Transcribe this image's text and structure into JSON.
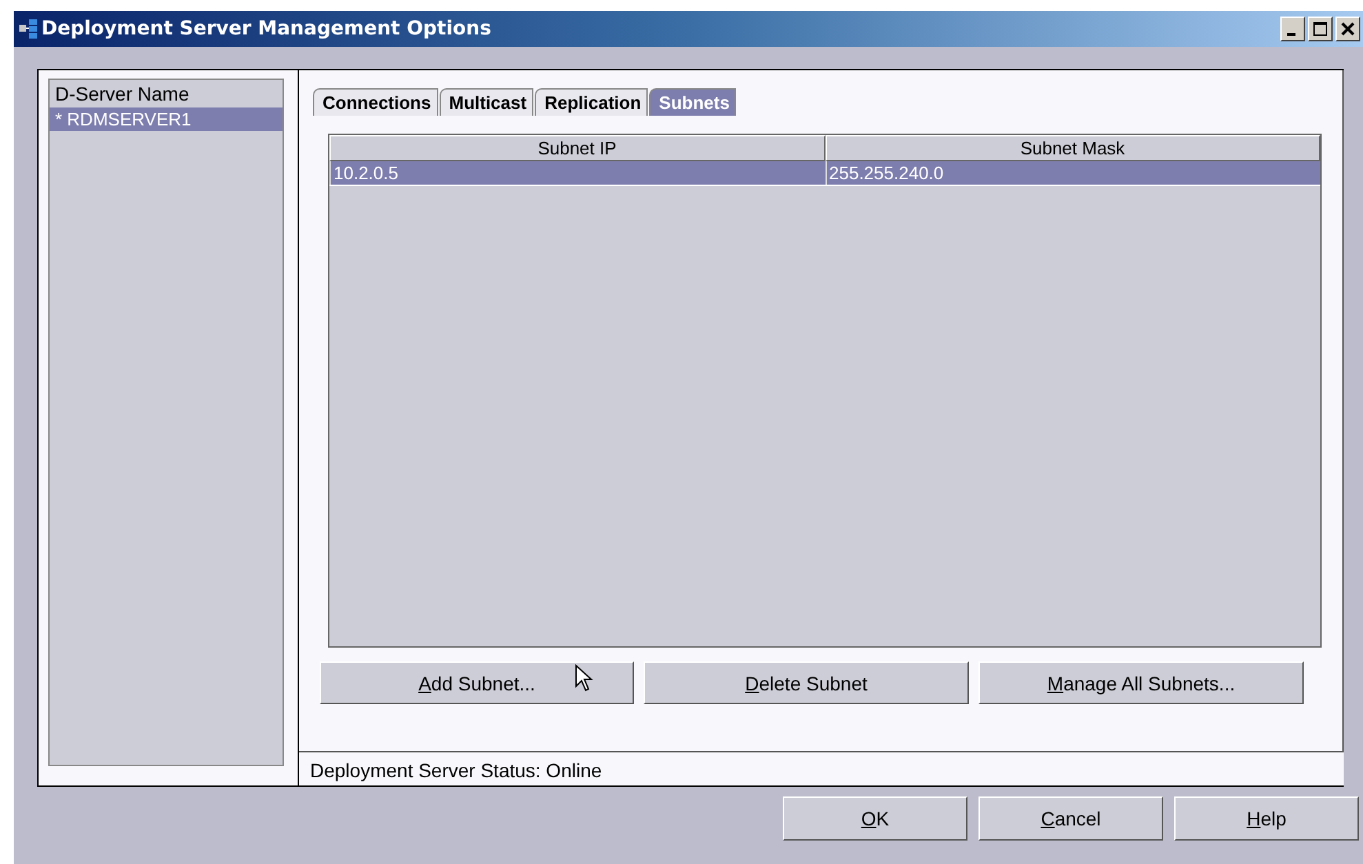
{
  "window": {
    "title": "Deployment Server Management Options"
  },
  "server_list": {
    "header": "D-Server Name",
    "items": [
      {
        "label": "* RDMSERVER1",
        "selected": true
      }
    ]
  },
  "tabs": [
    {
      "label": "Connections",
      "selected": false
    },
    {
      "label": "Multicast",
      "selected": false
    },
    {
      "label": "Replication",
      "selected": false
    },
    {
      "label": "Subnets",
      "selected": true
    }
  ],
  "table": {
    "columns": [
      "Subnet IP",
      "Subnet Mask"
    ],
    "rows": [
      {
        "cells": [
          "10.2.0.5",
          "255.255.240.0"
        ],
        "selected": true
      }
    ]
  },
  "panel_buttons": [
    {
      "label": "Add Subnet...",
      "mnemonic": true
    },
    {
      "label": "Delete Subnet",
      "mnemonic": true
    },
    {
      "label": "Manage All Subnets...",
      "mnemonic": true
    }
  ],
  "status": "Deployment Server Status: Online",
  "dialog_buttons": [
    {
      "label": "OK",
      "mnemonic": true
    },
    {
      "label": "Cancel",
      "mnemonic": true
    },
    {
      "label": "Help",
      "mnemonic": true
    }
  ]
}
